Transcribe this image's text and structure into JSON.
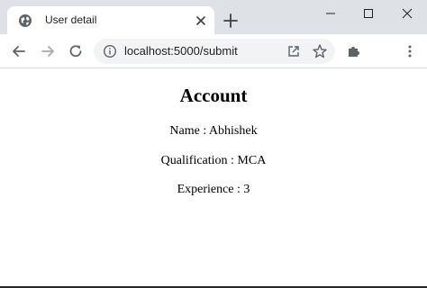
{
  "tab": {
    "title": "User detail"
  },
  "address_bar": {
    "url": "localhost:5000/submit"
  },
  "page": {
    "heading": "Account",
    "fields": [
      "Name : Abhishek",
      "Qualification : MCA",
      "Experience : 3"
    ]
  },
  "icons": {
    "favicon": "globe-icon",
    "back": "back-arrow-icon",
    "forward": "forward-arrow-icon",
    "reload": "reload-icon",
    "info": "info-icon",
    "share": "open-external-icon",
    "bookmark": "star-icon",
    "extensions": "puzzle-icon",
    "menu": "kebab-menu-icon"
  },
  "colors": {
    "tabstrip": "#dee1e6",
    "omnibox": "#f1f3f4",
    "icon": "#5f6368"
  }
}
